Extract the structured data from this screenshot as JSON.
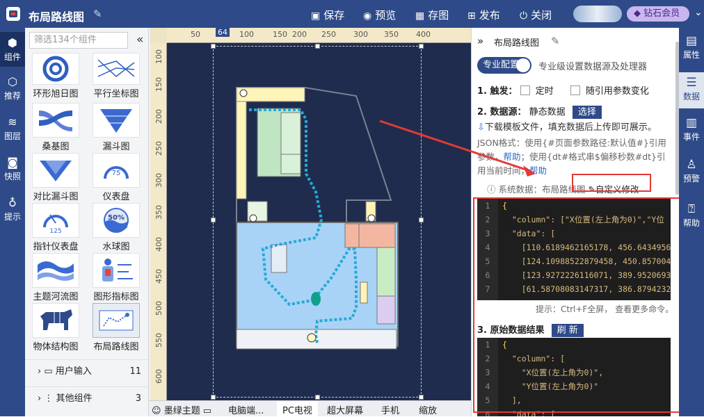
{
  "app": {
    "title": "布局路线图"
  },
  "toolbar": {
    "save": "保存",
    "preview": "预览",
    "save_image": "存图",
    "publish": "发布",
    "close": "关闭",
    "vip": "钻石会员"
  },
  "left_rail": [
    {
      "label": "组件"
    },
    {
      "label": "推荐"
    },
    {
      "label": "图层"
    },
    {
      "label": "快照"
    },
    {
      "label": "提示"
    }
  ],
  "component_panel": {
    "search_placeholder": "筛选134个组件",
    "items": [
      {
        "label": "环形旭日图"
      },
      {
        "label": "平行坐标图"
      },
      {
        "label": "桑基图"
      },
      {
        "label": "漏斗图"
      },
      {
        "label": "对比漏斗图"
      },
      {
        "label": "仪表盘"
      },
      {
        "label": "指针仪表盘"
      },
      {
        "label": "水球图"
      },
      {
        "label": "主题河流图"
      },
      {
        "label": "图形指标图"
      },
      {
        "label": "物体结构图"
      },
      {
        "label": "布局路线图"
      }
    ],
    "categories": [
      {
        "label": "用户输入",
        "count": "11"
      },
      {
        "label": "其他组件",
        "count": "3"
      }
    ]
  },
  "ruler": {
    "top": [
      "50",
      "64",
      "100",
      "150",
      "200",
      "250",
      "300",
      "350",
      "400"
    ],
    "left": [
      "100",
      "150",
      "200",
      "250",
      "300",
      "350",
      "400",
      "450",
      "500",
      "550",
      "600"
    ]
  },
  "canvas_bottom": {
    "theme": "墨绿主题",
    "items": [
      "电脑端...",
      "PC电视",
      "超大屏幕",
      "手机",
      "缩放"
    ]
  },
  "props": {
    "header": "布局路线图",
    "pro_toggle": "专业配置",
    "pro_desc": "专业级设置数据源及处理器",
    "trigger_label": "1. 触发：",
    "trigger_timer": "定时",
    "trigger_param": "随引用参数变化",
    "datasource_label": "2. 数据源：",
    "datasource_value": "静态数据",
    "select_btn": "选择",
    "download_text": "下载模板文件，填充数据后上传即可展示。",
    "json_help_1": "JSON格式：使用{#页面参数路径:默认值#}引用",
    "json_help_2": "参数，",
    "help_link": "帮助",
    "json_help_3": "；使用{dt#格式串$偏移秒数#dt}引",
    "json_help_4": "用当前时间，",
    "help_link_2": "帮助",
    "sys_data": "系统数据：布局路线图",
    "custom_edit": "自定义修改",
    "code1": [
      "{",
      "  \"column\": [\"X位置(左上角为0)\",\"Y位",
      "  \"data\": [",
      "    [110.6189462165178, 456.6434956",
      "    [124.10988522879458, 450.857004",
      "    [123.9272226116071, 389.9520693",
      "    [61.58708083147317, 386.8794232"
    ],
    "code_hint": "提示：Ctrl+F全屏， 查看更多命令。",
    "result_label": "3. 原始数据结果",
    "refresh_btn": "刷 新",
    "code2": [
      "{",
      "  \"column\": [",
      "    \"X位置(左上角为0)\",",
      "    \"Y位置(左上角为0)\"",
      "  ],",
      "  \"data\": ["
    ]
  },
  "right_rail": [
    {
      "label": "属性"
    },
    {
      "label": "数据"
    },
    {
      "label": "事件"
    },
    {
      "label": "预警"
    },
    {
      "label": "帮助"
    }
  ]
}
